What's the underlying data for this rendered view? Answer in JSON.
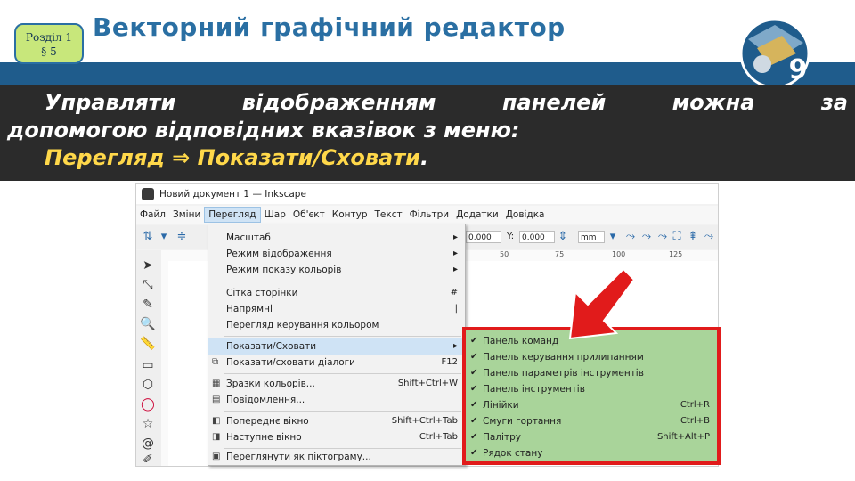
{
  "slide": {
    "section_line1": "Розділ 1",
    "section_line2": "§ 5",
    "title": "Векторний графічний редактор",
    "grade": "9"
  },
  "instruction": {
    "line1_words": [
      "Управляти",
      "відображенням",
      "панелей",
      "можна",
      "за"
    ],
    "line2": "допомогою відповідних вказівок з меню:",
    "line3_part1": "Перегляд",
    "line3_arrow": "⇒",
    "line3_part2": "Показати/Сховати",
    "line3_end": "."
  },
  "window": {
    "title": "Новий документ 1 — Inkscape",
    "menu": [
      "Файл",
      "Зміни",
      "Перегляд",
      "Шар",
      "Об'єкт",
      "Контур",
      "Текст",
      "Фільтри",
      "Додатки",
      "Довідка"
    ],
    "active_menu": "Перегляд",
    "toolbar": {
      "x_value": "0.000",
      "y_label": "Y:",
      "y_value": "0.000",
      "unit": "mm"
    },
    "ruler_numbers": [
      "50",
      "75",
      "100",
      "125"
    ]
  },
  "view_menu": {
    "items": [
      {
        "label": "Масштаб",
        "shortcut": "",
        "submenu": true,
        "icon": ""
      },
      {
        "label": "Режим відображення",
        "shortcut": "",
        "submenu": true,
        "icon": ""
      },
      {
        "label": "Режим показу кольорів",
        "shortcut": "",
        "submenu": true,
        "icon": ""
      },
      {
        "label": "Сітка сторінки",
        "shortcut": "#",
        "submenu": false,
        "icon": ""
      },
      {
        "label": "Напрямні",
        "shortcut": "|",
        "submenu": false,
        "icon": ""
      },
      {
        "label": "Перегляд керування кольором",
        "shortcut": "",
        "submenu": false,
        "icon": ""
      },
      {
        "label": "Показати/Сховати",
        "shortcut": "",
        "submenu": true,
        "icon": ""
      },
      {
        "label": "Показати/сховати діалоги",
        "shortcut": "F12",
        "submenu": false,
        "icon": "dialog-icon"
      },
      {
        "label": "Зразки кольорів...",
        "shortcut": "Shift+Ctrl+W",
        "submenu": false,
        "icon": "swatches-icon"
      },
      {
        "label": "Повідомлення...",
        "shortcut": "",
        "submenu": false,
        "icon": "messages-icon"
      },
      {
        "label": "Попереднє вікно",
        "shortcut": "Shift+Ctrl+Tab",
        "submenu": false,
        "icon": "prev-window-icon"
      },
      {
        "label": "Наступне вікно",
        "shortcut": "Ctrl+Tab",
        "submenu": false,
        "icon": "next-window-icon"
      },
      {
        "label": "Переглянути як піктограму...",
        "shortcut": "",
        "submenu": false,
        "icon": "icon-preview-icon"
      }
    ]
  },
  "show_hide_submenu": {
    "items": [
      {
        "label": "Панель команд",
        "shortcut": "",
        "checked": "✔"
      },
      {
        "label": "Панель керування прилипанням",
        "shortcut": "",
        "checked": "✔"
      },
      {
        "label": "Панель параметрів інструментів",
        "shortcut": "",
        "checked": "✔"
      },
      {
        "label": "Панель інструментів",
        "shortcut": "",
        "checked": "✔"
      },
      {
        "label": "Лінійки",
        "shortcut": "Ctrl+R",
        "checked": "✔"
      },
      {
        "label": "Смуги гортання",
        "shortcut": "Ctrl+B",
        "checked": "✔"
      },
      {
        "label": "Палітру",
        "shortcut": "Shift+Alt+P",
        "checked": "✔"
      },
      {
        "label": "Рядок стану",
        "shortcut": "",
        "checked": "✔"
      }
    ]
  },
  "colors": {
    "header_blue": "#1f5c8c",
    "highlight_red": "#e11b1b",
    "submenu_green": "#a9d49a"
  }
}
